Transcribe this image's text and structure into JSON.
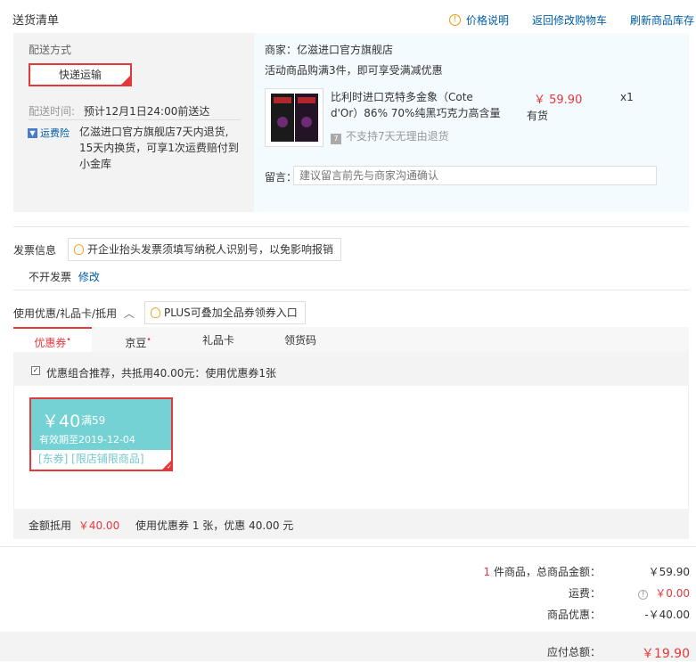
{
  "header": {
    "title": "送货清单",
    "links": [
      "价格说明",
      "返回修改购物车",
      "刷新商品库存"
    ]
  },
  "shipping": {
    "method_label": "配送方式",
    "method_value": "快递运输",
    "time_label": "配送时间:",
    "time_value": "预计12月1日24:00前送达",
    "insurance_badge": "运费险",
    "insurance_text_1": "亿滋进口官方旗舰店7天内退货,",
    "insurance_text_2": "15天内换货，可享1次运费赔付到",
    "insurance_text_3": "小金库"
  },
  "merchant": {
    "name": "商家：亿滋进口官方旗舰店",
    "promo": "活动商品购满3件，即可享受满减优惠",
    "product_title_1": "比利时进口克特多金象（Cote",
    "product_title_2": "d'Or）86% 70%纯黑巧克力高含量",
    "no_return": "不支持7天无理由退货",
    "price": "￥ 59.90",
    "stock": "有货",
    "qty": "x1",
    "message_label": "留言：",
    "message_placeholder": "建议留言前先与商家沟通确认"
  },
  "invoice": {
    "title": "发票信息",
    "tip": "开企业抬头发票须填写纳税人识别号，以免影响报销",
    "value": "不开发票",
    "edit": "修改"
  },
  "coupon": {
    "title": "使用优惠/礼品卡/抵用",
    "plus_tip": "PLUS可叠加全品券领券入口",
    "tabs": [
      {
        "label": "优惠券",
        "dot": "•"
      },
      {
        "label": "京豆",
        "dot": "•"
      },
      {
        "label": "礼品卡",
        "dot": ""
      },
      {
        "label": "领货码",
        "dot": ""
      }
    ],
    "recommend": "优惠组合推荐，共抵用40.00元：使用优惠券1张",
    "card_amount": "￥40",
    "card_condition": "满59",
    "card_expiry": "有效期至2019-12-04",
    "card_scope": "[东券] [限店铺限商品]",
    "summary_label": "金额抵用",
    "summary_amount": "￥40.00",
    "summary_detail": "使用优惠券 1 张，优惠 40.00 元"
  },
  "totals": {
    "count": "1",
    "count_label": "件商品，总商品金额：",
    "goods_amount": "￥59.90",
    "freight_label": "运费：",
    "freight_amount": "￥0.00",
    "discount_label": "商品优惠：",
    "discount_amount": "-￥40.00",
    "payable_label": "应付总额：",
    "payable_amount": "￥19.90"
  }
}
